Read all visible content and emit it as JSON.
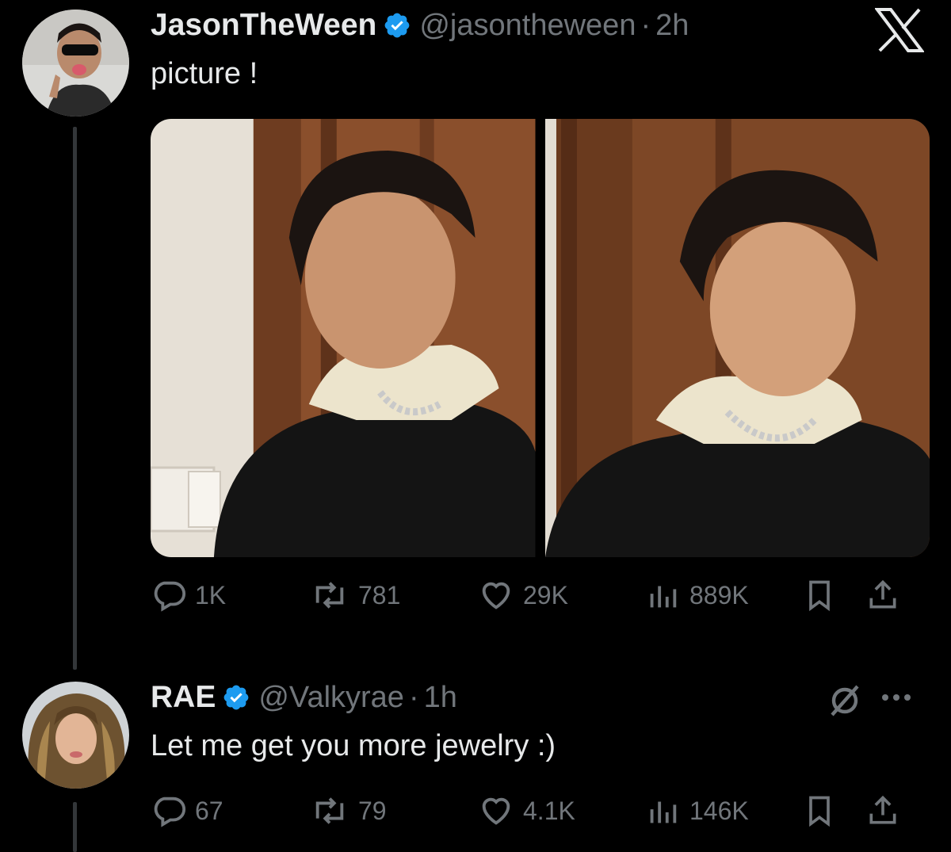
{
  "brand": {
    "logo": "x-logo-icon"
  },
  "tweets": [
    {
      "display_name": "JasonTheWeen",
      "handle": "@jasontheween",
      "time": "2h",
      "text": "picture !",
      "verified_color": "#1d9bf0",
      "media_count": 2,
      "stats": {
        "replies": "1K",
        "reposts": "781",
        "likes": "29K",
        "views": "889K"
      }
    },
    {
      "display_name": "RAE",
      "handle": "@Valkyrae",
      "time": "1h",
      "text": "Let me get you more jewelry :)",
      "verified_color": "#1d9bf0",
      "stats": {
        "replies": "67",
        "reposts": "79",
        "likes": "4.1K",
        "views": "146K"
      }
    }
  ],
  "colors": {
    "background": "#000000",
    "primary_text": "#e7e9ea",
    "secondary_text": "#71767b",
    "thread_line": "#333639"
  }
}
